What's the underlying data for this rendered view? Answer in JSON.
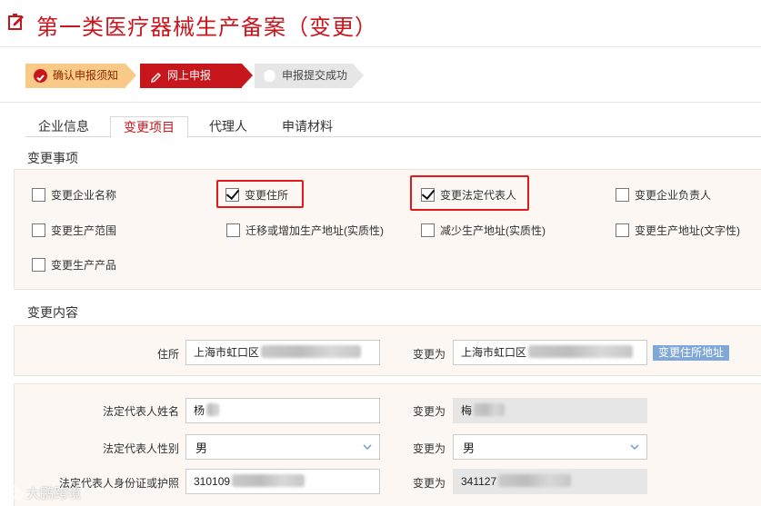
{
  "header": {
    "title": "第一类医疗器械生产备案（变更）"
  },
  "steps": [
    {
      "label": "确认申报须知",
      "state": "done"
    },
    {
      "label": "网上申报",
      "state": "current"
    },
    {
      "label": "申报提交成功",
      "state": "pending"
    }
  ],
  "tabs": [
    {
      "label": "企业信息",
      "active": false
    },
    {
      "label": "变更项目",
      "active": true
    },
    {
      "label": "代理人",
      "active": false
    },
    {
      "label": "申请材料",
      "active": false
    }
  ],
  "change_items": {
    "section_title": "变更事项",
    "options": [
      {
        "label": "变更企业名称",
        "checked": false
      },
      {
        "label": "变更住所",
        "checked": true
      },
      {
        "label": "变更法定代表人",
        "checked": true
      },
      {
        "label": "变更企业负责人",
        "checked": false
      },
      {
        "label": "变更生产范围",
        "checked": false
      },
      {
        "label": "迁移或增加生产地址(实质性)",
        "checked": false
      },
      {
        "label": "减少生产地址(实质性)",
        "checked": false
      },
      {
        "label": "变更生产地址(文字性)",
        "checked": false
      },
      {
        "label": "变更生产产品",
        "checked": false
      }
    ]
  },
  "change_content": {
    "section_title": "变更内容",
    "address": {
      "label": "住所",
      "value": "上海市虹口区",
      "change_to_label": "变更为",
      "new_value": "上海市虹口区",
      "button_label": "变更住所地址"
    },
    "legal_rep": {
      "name_label": "法定代表人姓名",
      "name_value": "杨",
      "name_change_label": "变更为",
      "name_new_value": "梅",
      "gender_label": "法定代表人性别",
      "gender_value": "男",
      "gender_change_label": "变更为",
      "gender_new_value": "男",
      "id_label": "法定代表人身份证或护照",
      "id_value": "310109",
      "id_change_label": "变更为",
      "id_new_value": "341127"
    }
  },
  "watermark": {
    "text": "大鹏跨境"
  },
  "colors": {
    "brand_red": "#c8161d",
    "highlight_red": "#e0191d",
    "step_done": "#f9c988",
    "button_blue": "#7fa8d8"
  }
}
